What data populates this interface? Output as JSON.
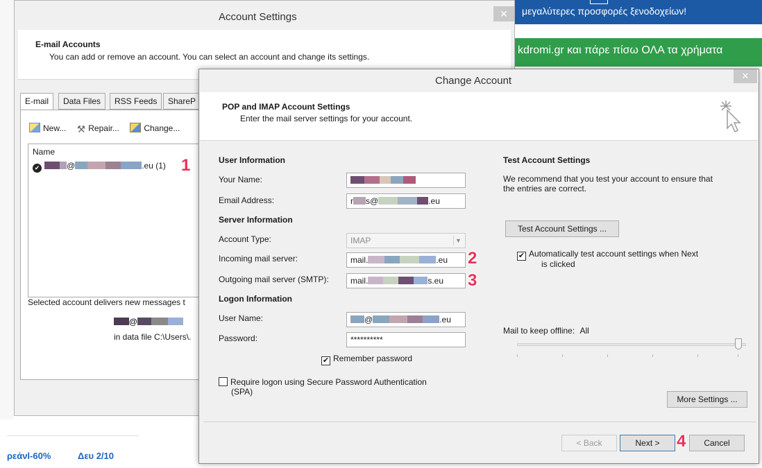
{
  "background_page": {
    "banner_top": "μεγαλύτερες προσφορές ξενοδοχείων!",
    "banner_green": "kdromi.gr και πάρε πίσω ΟΛΑ τα χρήματα",
    "price_link": "ρεάνl-60%",
    "date_link": "Δευ 2/10"
  },
  "account_settings": {
    "title": "Account Settings",
    "close": "✕",
    "header_title": "E-mail Accounts",
    "header_sub": "You can add or remove an account. You can select an account and change its settings.",
    "tabs": [
      "E-mail",
      "Data Files",
      "RSS Feeds",
      "ShareP"
    ],
    "toolbar": {
      "new": "New...",
      "repair": "Repair...",
      "change": "Change..."
    },
    "list_header": "Name",
    "account_row": {
      "prefix": "@",
      "suffix": ".eu (1)"
    },
    "delivers_text": "Selected account delivers new messages t",
    "delivers_email_suffix": "@",
    "delivers_file": "in data file C:\\Users\\."
  },
  "change_account": {
    "title": "Change Account",
    "close": "✕",
    "header_title": "POP and IMAP Account Settings",
    "header_sub": "Enter the mail server settings for your account.",
    "user_info": "User Information",
    "your_name_label": "Your Name:",
    "email_label": "Email Address:",
    "email_value": {
      "start": "r",
      "mid": "s@",
      "end": ".eu"
    },
    "server_info": "Server Information",
    "account_type_label": "Account Type:",
    "account_type_value": "IMAP",
    "incoming_label": "Incoming mail server:",
    "incoming_value": {
      "start": "mail.",
      "end": ".eu"
    },
    "outgoing_label": "Outgoing mail server (SMTP):",
    "outgoing_value": {
      "start": "mail.",
      "end": "s.eu"
    },
    "logon_info": "Logon Information",
    "username_label": "User Name:",
    "username_value": {
      "mid": "@",
      "end": ".eu"
    },
    "password_label": "Password:",
    "password_value": "**********",
    "remember_password": "Remember password",
    "spa_line1": "Require logon using Secure Password Authentication",
    "spa_line2": "(SPA)",
    "test_title": "Test Account Settings",
    "test_desc_1": "We recommend that you test your account to ensure that",
    "test_desc_2": "the entries are correct.",
    "test_button": "Test Account Settings ...",
    "auto_test_1": "Automatically test account settings when Next",
    "auto_test_2": "is clicked",
    "offline_label": "Mail to keep offline:",
    "offline_value": "All",
    "more_settings": "More Settings ...",
    "back_button": "< Back",
    "next_button": "Next >",
    "cancel_button": "Cancel"
  },
  "callouts": [
    "1",
    "2",
    "3",
    "4"
  ],
  "state": {
    "remember_password_checked": true,
    "spa_checked": false,
    "auto_test_checked": true,
    "offline_slider_level": 1.0
  },
  "colors": {
    "callout": "#e8335a",
    "banner_blue": "#1c5aa6",
    "banner_green": "#2f9d4a",
    "link_blue": "#1c64c0"
  }
}
